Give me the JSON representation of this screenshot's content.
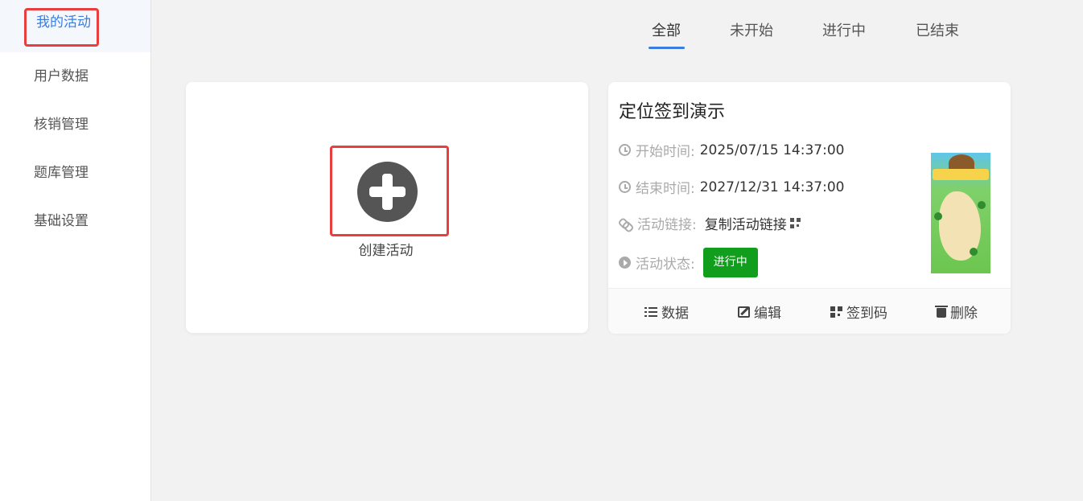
{
  "sidebar": {
    "items": [
      {
        "label": "我的活动",
        "active": true
      },
      {
        "label": "用户数据"
      },
      {
        "label": "核销管理"
      },
      {
        "label": "题库管理"
      },
      {
        "label": "基础设置"
      }
    ]
  },
  "tabs": [
    {
      "label": "全部",
      "active": true
    },
    {
      "label": "未开始"
    },
    {
      "label": "进行中"
    },
    {
      "label": "已结束"
    }
  ],
  "create_card": {
    "label": "创建活动",
    "icon": "plus-circle-icon"
  },
  "activity": {
    "title": "定位签到演示",
    "start_label": "开始时间:",
    "start_value": "2025/07/15 14:37:00",
    "end_label": "结束时间:",
    "end_value": "2027/12/31 14:37:00",
    "link_label": "活动链接:",
    "link_value": "复制活动链接",
    "status_label": "活动状态:",
    "status_value": "进行中",
    "status_color": "#119e1c",
    "actions": {
      "data": "数据",
      "edit": "编辑",
      "qrcode": "签到码",
      "delete": "删除"
    }
  },
  "colors": {
    "accent": "#3b7ddd",
    "highlight": "#e83e3e"
  }
}
